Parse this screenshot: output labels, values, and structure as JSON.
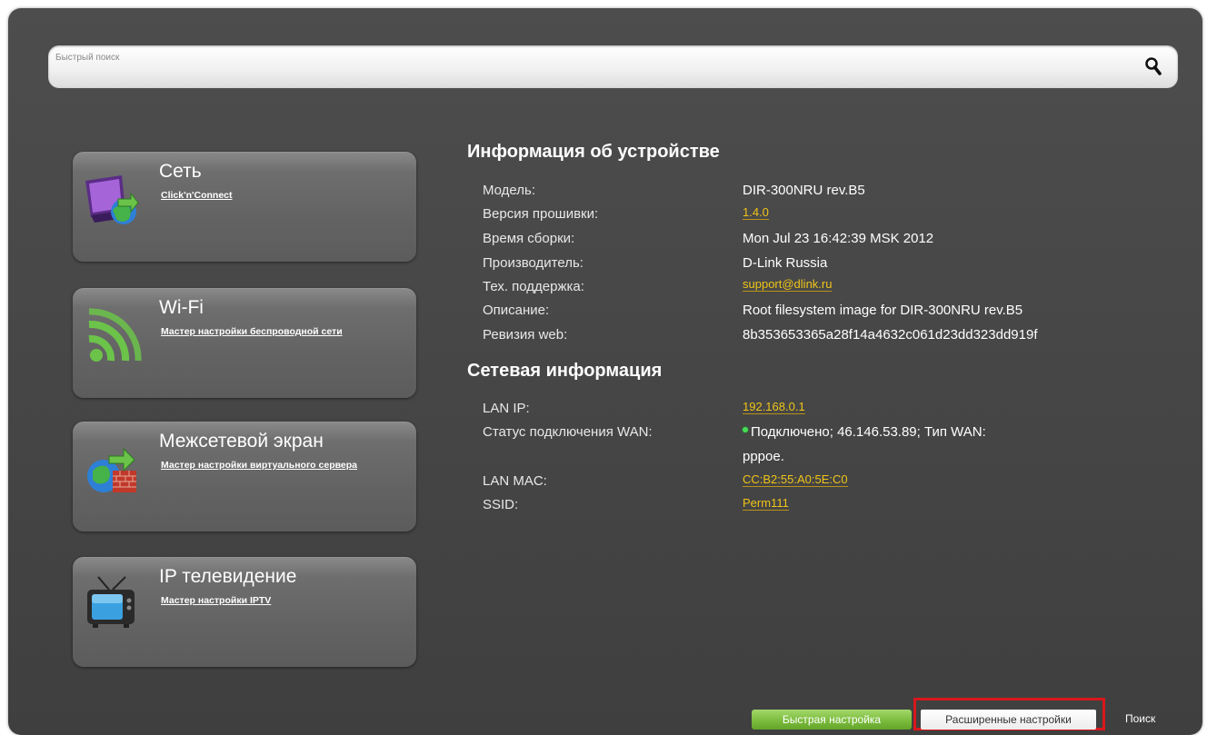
{
  "search": {
    "placeholder": "Быстрый поиск"
  },
  "cards": [
    {
      "title": "Сеть",
      "link": "Click'n'Connect",
      "icon": "network-monitor-icon"
    },
    {
      "title": "Wi-Fi",
      "link": "Мастер настройки беспроводной сети",
      "icon": "wifi-signal-icon"
    },
    {
      "title": "Межсетевой экран",
      "link": "Мастер настройки виртуального сервера",
      "icon": "firewall-globe-icon"
    },
    {
      "title": "IP телевидение",
      "link": "Мастер настройки IPTV",
      "icon": "tv-icon"
    }
  ],
  "device_info": {
    "title": "Информация об устройстве",
    "model_label": "Модель:",
    "model_value": "DIR-300NRU rev.B5",
    "firmware_label": "Версия прошивки:",
    "firmware_value": "1.4.0",
    "build_label": "Время сборки:",
    "build_value": "Mon Jul 23 16:42:39 MSK 2012",
    "vendor_label": "Производитель:",
    "vendor_value": "D-Link Russia",
    "support_label": "Тех. поддержка:",
    "support_value": "support@dlink.ru",
    "desc_label": "Описание:",
    "desc_value": "Root filesystem image for DIR-300NRU rev.B5",
    "web_rev_label": "Ревизия web:",
    "web_rev_value": "8b353653365a28f14a4632c061d23dd323dd919f"
  },
  "network_info": {
    "title": "Сетевая информация",
    "lan_ip_label": "LAN IP:",
    "lan_ip_value": "192.168.0.1",
    "wan_status_label": "Статус подключения WAN:",
    "wan_status_line1": "Подключено; 46.146.53.89; Тип WAN:",
    "wan_status_line2": "pppoe.",
    "lan_mac_label": "LAN MAC:",
    "lan_mac_value": "CC:B2:55:A0:5E:C0",
    "ssid_label": "SSID:",
    "ssid_value": "Perm111"
  },
  "footer": {
    "quick_setup": "Быстрая настройка",
    "advanced_settings": "Расширенные настройки",
    "search": "Поиск"
  },
  "colors": {
    "panel": "#474747",
    "link": "#f0c419",
    "quick_button": "#7cbc3e",
    "highlight_border": "#d8171c",
    "status_ok": "#44dd55"
  }
}
